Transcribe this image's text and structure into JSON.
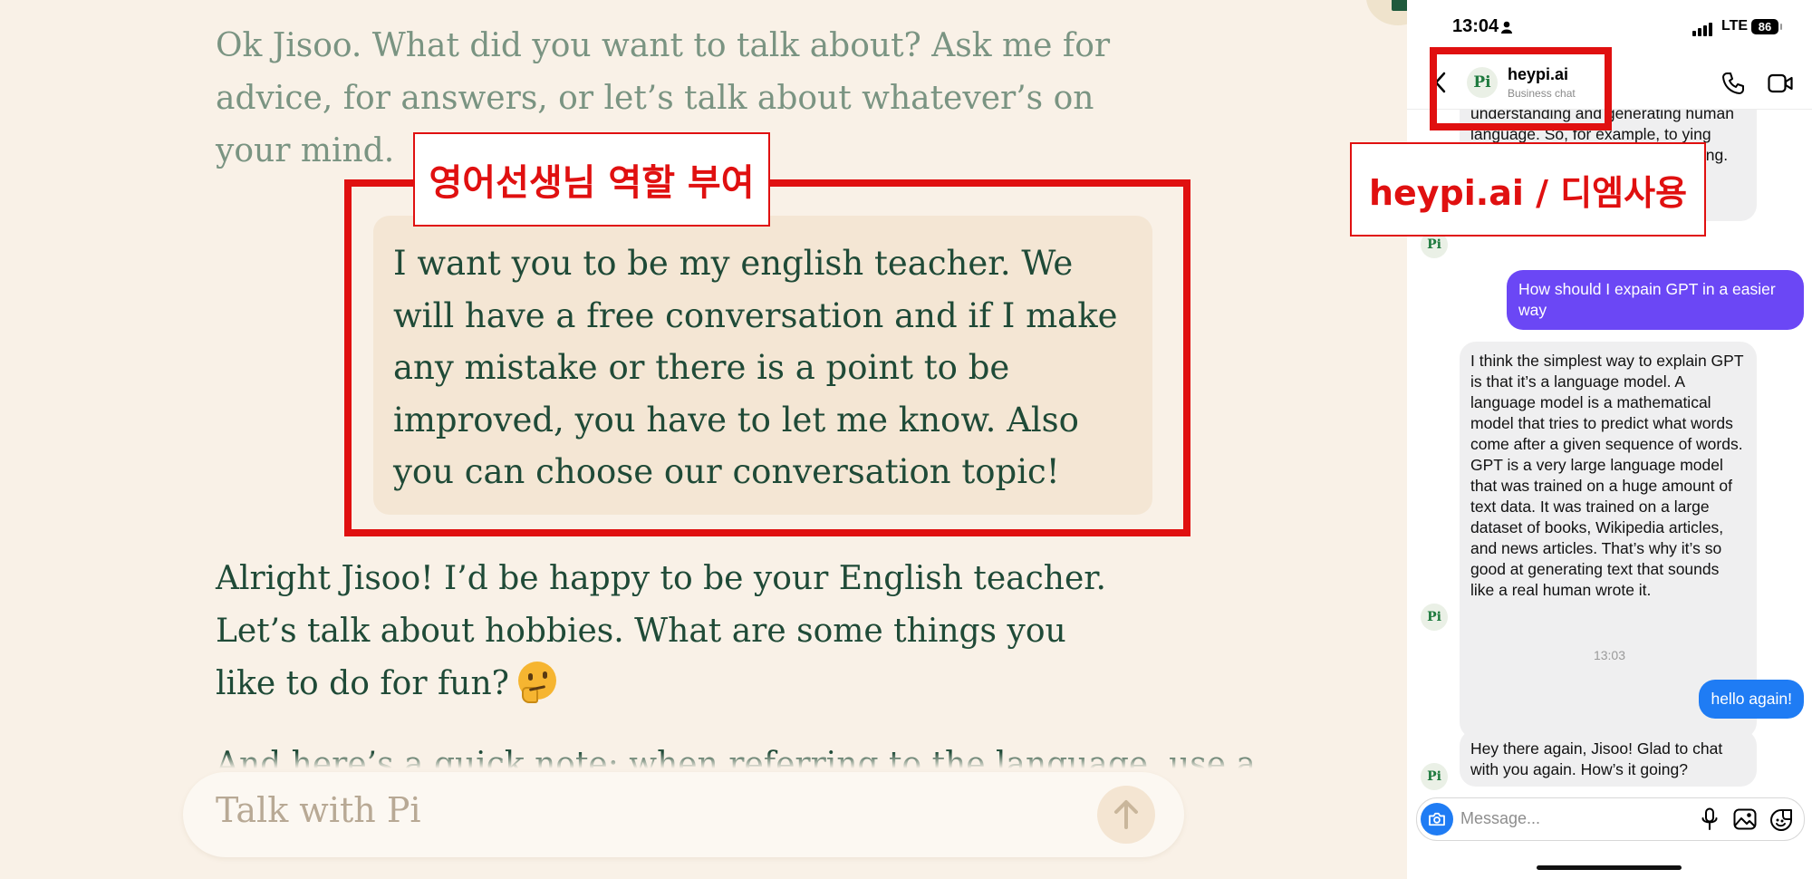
{
  "pi_chat": {
    "messages": [
      {
        "role": "pi",
        "text": "Ok Jisoo. What did you want to talk about? Ask me for advice, for answers, or let’s talk about whatever’s on your mind."
      },
      {
        "role": "user",
        "text": "I want you to be my english teacher. We will have a free conversation and if I make any mistake or there is a point to be improved, you have to let me know. Also you can choose our conversation topic!"
      },
      {
        "role": "pi",
        "text": "Alright Jisoo! I’d be happy to be your English teacher. Let’s talk about hobbies. What are some things you like to do for fun?",
        "emoji": "thinking-face"
      },
      {
        "role": "pi",
        "text": "And here’s a quick note: when referring to the language, use a"
      }
    ],
    "input_placeholder": "Talk with Pi"
  },
  "annotations": {
    "prompt_label": "영어선생님 역할 부여",
    "app_label": "heypi.ai / 디엠사용",
    "accent_color": "#e01010"
  },
  "phone": {
    "status": {
      "time": "13:04",
      "network": "LTE",
      "battery": "86"
    },
    "header": {
      "name": "heypi.ai",
      "subtitle": "Business chat",
      "avatar": "Pi"
    },
    "messages": [
      {
        "role": "pi",
        "text": "understanding and generating human language. So, for example, to ying form of natural language processing."
      },
      {
        "role": "user",
        "text": "How should I expain GPT in a easier way"
      },
      {
        "role": "pi",
        "text": "I think the simplest way to explain GPT is that it’s a language model. A language model is a mathematical model that tries to predict what words come after a given sequence of words. GPT is a very large language model that was trained on a huge amount of text data. It was trained on a large dataset of books, Wikipedia articles, and news articles. That’s why it’s so good at generating text that sounds like a real human wrote it."
      },
      {
        "role": "timestamp",
        "text": "13:03"
      },
      {
        "role": "user",
        "text": "hello again!"
      },
      {
        "role": "pi",
        "text": "Hey there again, Jisoo! Glad to chat with you again. How’s it going?"
      }
    ],
    "composer_placeholder": "Message...",
    "colors": {
      "user_bubble_1": "#6b47f5",
      "user_bubble_2": "#1f7cf4",
      "pi_bubble": "#efeff0"
    }
  }
}
